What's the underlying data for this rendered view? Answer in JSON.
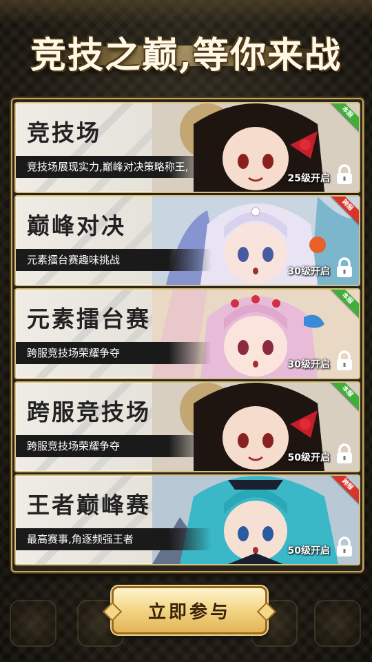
{
  "header": {
    "title": "竞技之巅,等你来战"
  },
  "cards": [
    {
      "name": "竞技场",
      "desc": "竞技场展现实力,巅峰对决策略称王,",
      "unlock": "25级开启",
      "badge": "本服",
      "badge_color": "green"
    },
    {
      "name": "巅峰对决",
      "desc": "元素擂台赛趣味挑战",
      "unlock": "30级开启",
      "badge": "跨服",
      "badge_color": "red"
    },
    {
      "name": "元素擂台赛",
      "desc": "跨服竞技场荣耀争夺",
      "unlock": "30级开启",
      "badge": "本服",
      "badge_color": "green"
    },
    {
      "name": "跨服竞技场",
      "desc": "跨服竞技场荣耀争夺",
      "unlock": "50级开启",
      "badge": "本服",
      "badge_color": "green"
    },
    {
      "name": "王者巅峰赛",
      "desc": "最高赛事,角逐频强王者",
      "unlock": "50级开启",
      "badge": "跨服",
      "badge_color": "red"
    }
  ],
  "join_button": {
    "label": "立即参与"
  },
  "colors": {
    "gold": "#c9a85a",
    "button": "#f4d88a",
    "badge_green": "#3fae3a",
    "badge_red": "#d8342c"
  }
}
